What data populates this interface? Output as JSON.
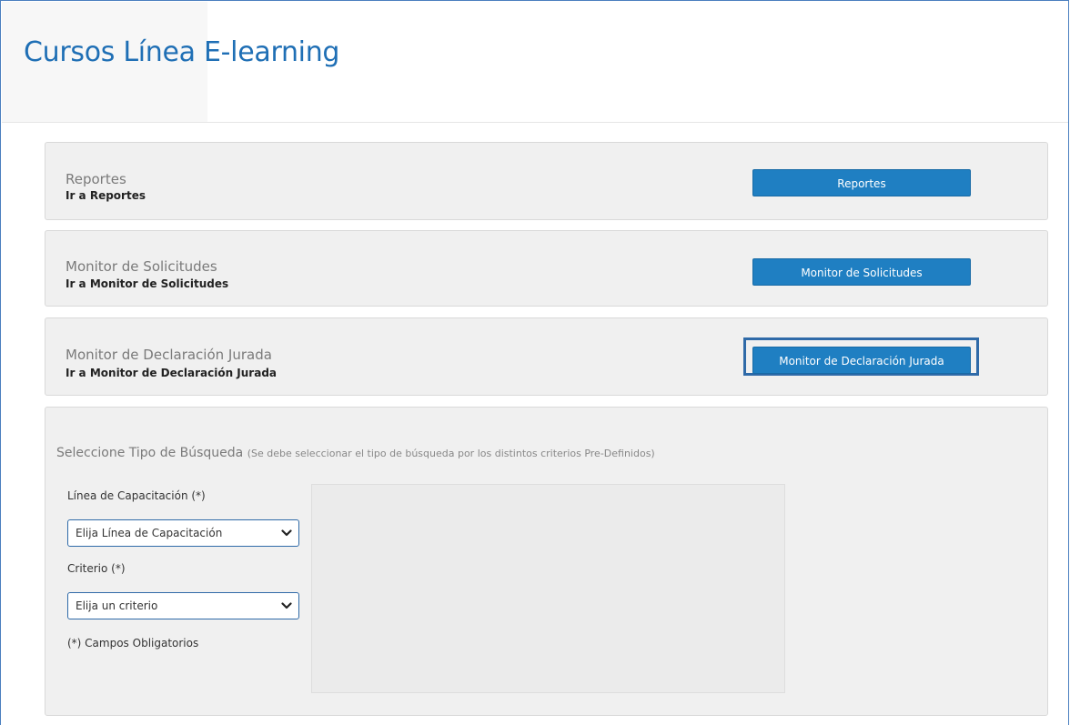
{
  "page": {
    "title": "Cursos Línea E-learning"
  },
  "panels": [
    {
      "title": "Reportes",
      "link": "Ir a Reportes",
      "button": "Reportes"
    },
    {
      "title": "Monitor de Solicitudes",
      "link": "Ir a Monitor de Solicitudes",
      "button": "Monitor de Solicitudes"
    },
    {
      "title": "Monitor de Declaración Jurada",
      "link": "Ir a Monitor de Declaración Jurada",
      "button": "Monitor de Declaración Jurada"
    }
  ],
  "search": {
    "title": "Seleccione Tipo de Búsqueda",
    "note": "(Se debe seleccionar el tipo de búsqueda por los distintos criterios Pre-Definidos)",
    "linea_label": "Línea de Capacitación (*)",
    "linea_selected": "Elija Línea de Capacitación",
    "criterio_label": "Criterio (*)",
    "criterio_selected": "Elija un criterio",
    "required_note": "(*) Campos Obligatorios"
  },
  "icons": {
    "select_arrow": "chevron-down-icon"
  },
  "colors": {
    "title_blue": "#1f6fb5",
    "button_blue": "#1f7fc2",
    "focus_outline": "#2f6aa8",
    "panel_bg": "#f0f0f0"
  }
}
